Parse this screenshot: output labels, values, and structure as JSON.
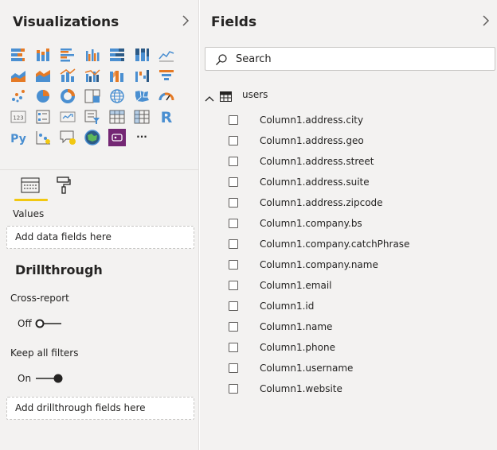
{
  "visualizations": {
    "title": "Visualizations",
    "expand_icon": "chevron-right-icon",
    "icons": [
      [
        "stacked-bar-chart",
        "stacked-column-chart",
        "clustered-bar-chart",
        "clustered-column-chart",
        "100pct-stacked-bar-chart",
        "100pct-stacked-column-chart",
        "line-chart"
      ],
      [
        "area-chart",
        "stacked-area-chart",
        "line-and-stacked-column-chart",
        "line-and-clustered-column-chart",
        "ribbon-chart",
        "waterfall-chart",
        "funnel-chart"
      ],
      [
        "scatter-chart",
        "pie-chart",
        "donut-chart",
        "treemap",
        "map",
        "filled-map",
        "gauge"
      ],
      [
        "card",
        "multi-row-card",
        "kpi",
        "slicer",
        "table",
        "matrix",
        "r-script-visual"
      ],
      [
        "python-visual",
        "key-influencers",
        "qa-visual",
        "arcgis-map",
        "power-apps",
        "more-visuals"
      ]
    ],
    "r_label": "R",
    "py_label": "Py",
    "card_label": "123",
    "more_label": "···",
    "tabs": {
      "fields_tab_icon": "fields-well-icon",
      "format_tab_icon": "paint-roller-icon"
    },
    "values_label": "Values",
    "values_placeholder": "Add data fields here",
    "drillthrough_title": "Drillthrough",
    "cross_report_label": "Cross-report",
    "cross_report_state": "Off",
    "keep_filters_label": "Keep all filters",
    "keep_filters_state": "On",
    "drillthrough_placeholder": "Add drillthrough fields here"
  },
  "fields": {
    "title": "Fields",
    "expand_icon": "chevron-right-icon",
    "search_placeholder": "Search",
    "table_name": "users",
    "items": [
      "Column1.address.city",
      "Column1.address.geo",
      "Column1.address.street",
      "Column1.address.suite",
      "Column1.address.zipcode",
      "Column1.company.bs",
      "Column1.company.catchPhrase",
      "Column1.company.name",
      "Column1.email",
      "Column1.id",
      "Column1.name",
      "Column1.phone",
      "Column1.username",
      "Column1.website"
    ]
  },
  "colors": {
    "accent": "#f2c811",
    "chart_blue": "#4a8fd1",
    "chart_orange": "#e57a25",
    "powerapps": "#742774"
  }
}
